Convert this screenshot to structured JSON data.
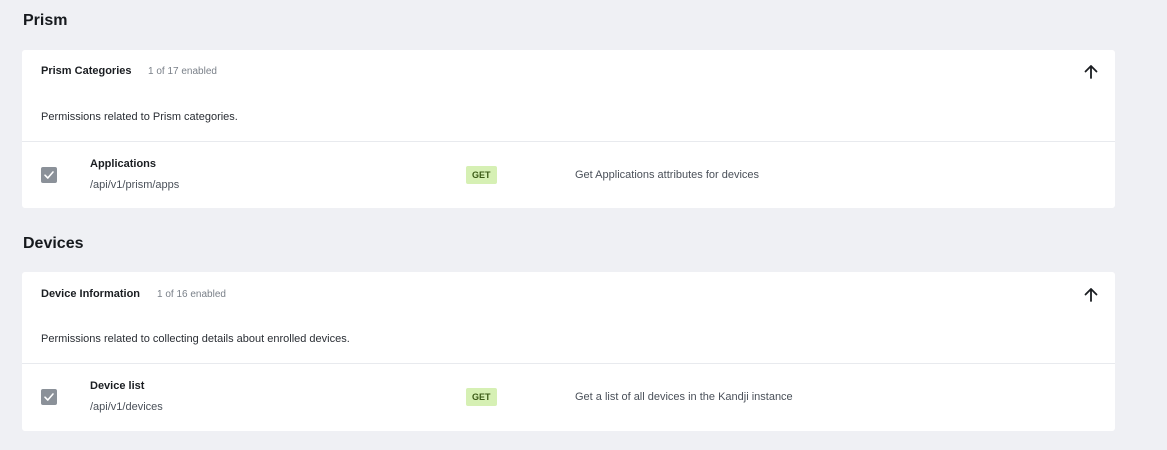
{
  "sections": [
    {
      "title": "Prism",
      "category": {
        "name": "Prism Categories",
        "count": "1 of 17 enabled",
        "description": "Permissions related to Prism categories.",
        "collapse_icon": "arrow-up-icon",
        "permissions": [
          {
            "name": "Applications",
            "path": "/api/v1/prism/apps",
            "method": "GET",
            "description": "Get Applications attributes for devices",
            "checked": true
          }
        ]
      }
    },
    {
      "title": "Devices",
      "category": {
        "name": "Device Information",
        "count": "1 of 16 enabled",
        "description": "Permissions related to collecting details about enrolled devices.",
        "collapse_icon": "arrow-up-icon",
        "permissions": [
          {
            "name": "Device list",
            "path": "/api/v1/devices",
            "method": "GET",
            "description": "Get a list of all devices in the Kandji instance",
            "checked": true
          }
        ]
      }
    }
  ],
  "colors": {
    "background": "#eff0f4",
    "card": "#ffffff",
    "badge_bg": "#d6f0b4",
    "badge_text": "#3b5a16",
    "checkbox": "#8b9199"
  }
}
